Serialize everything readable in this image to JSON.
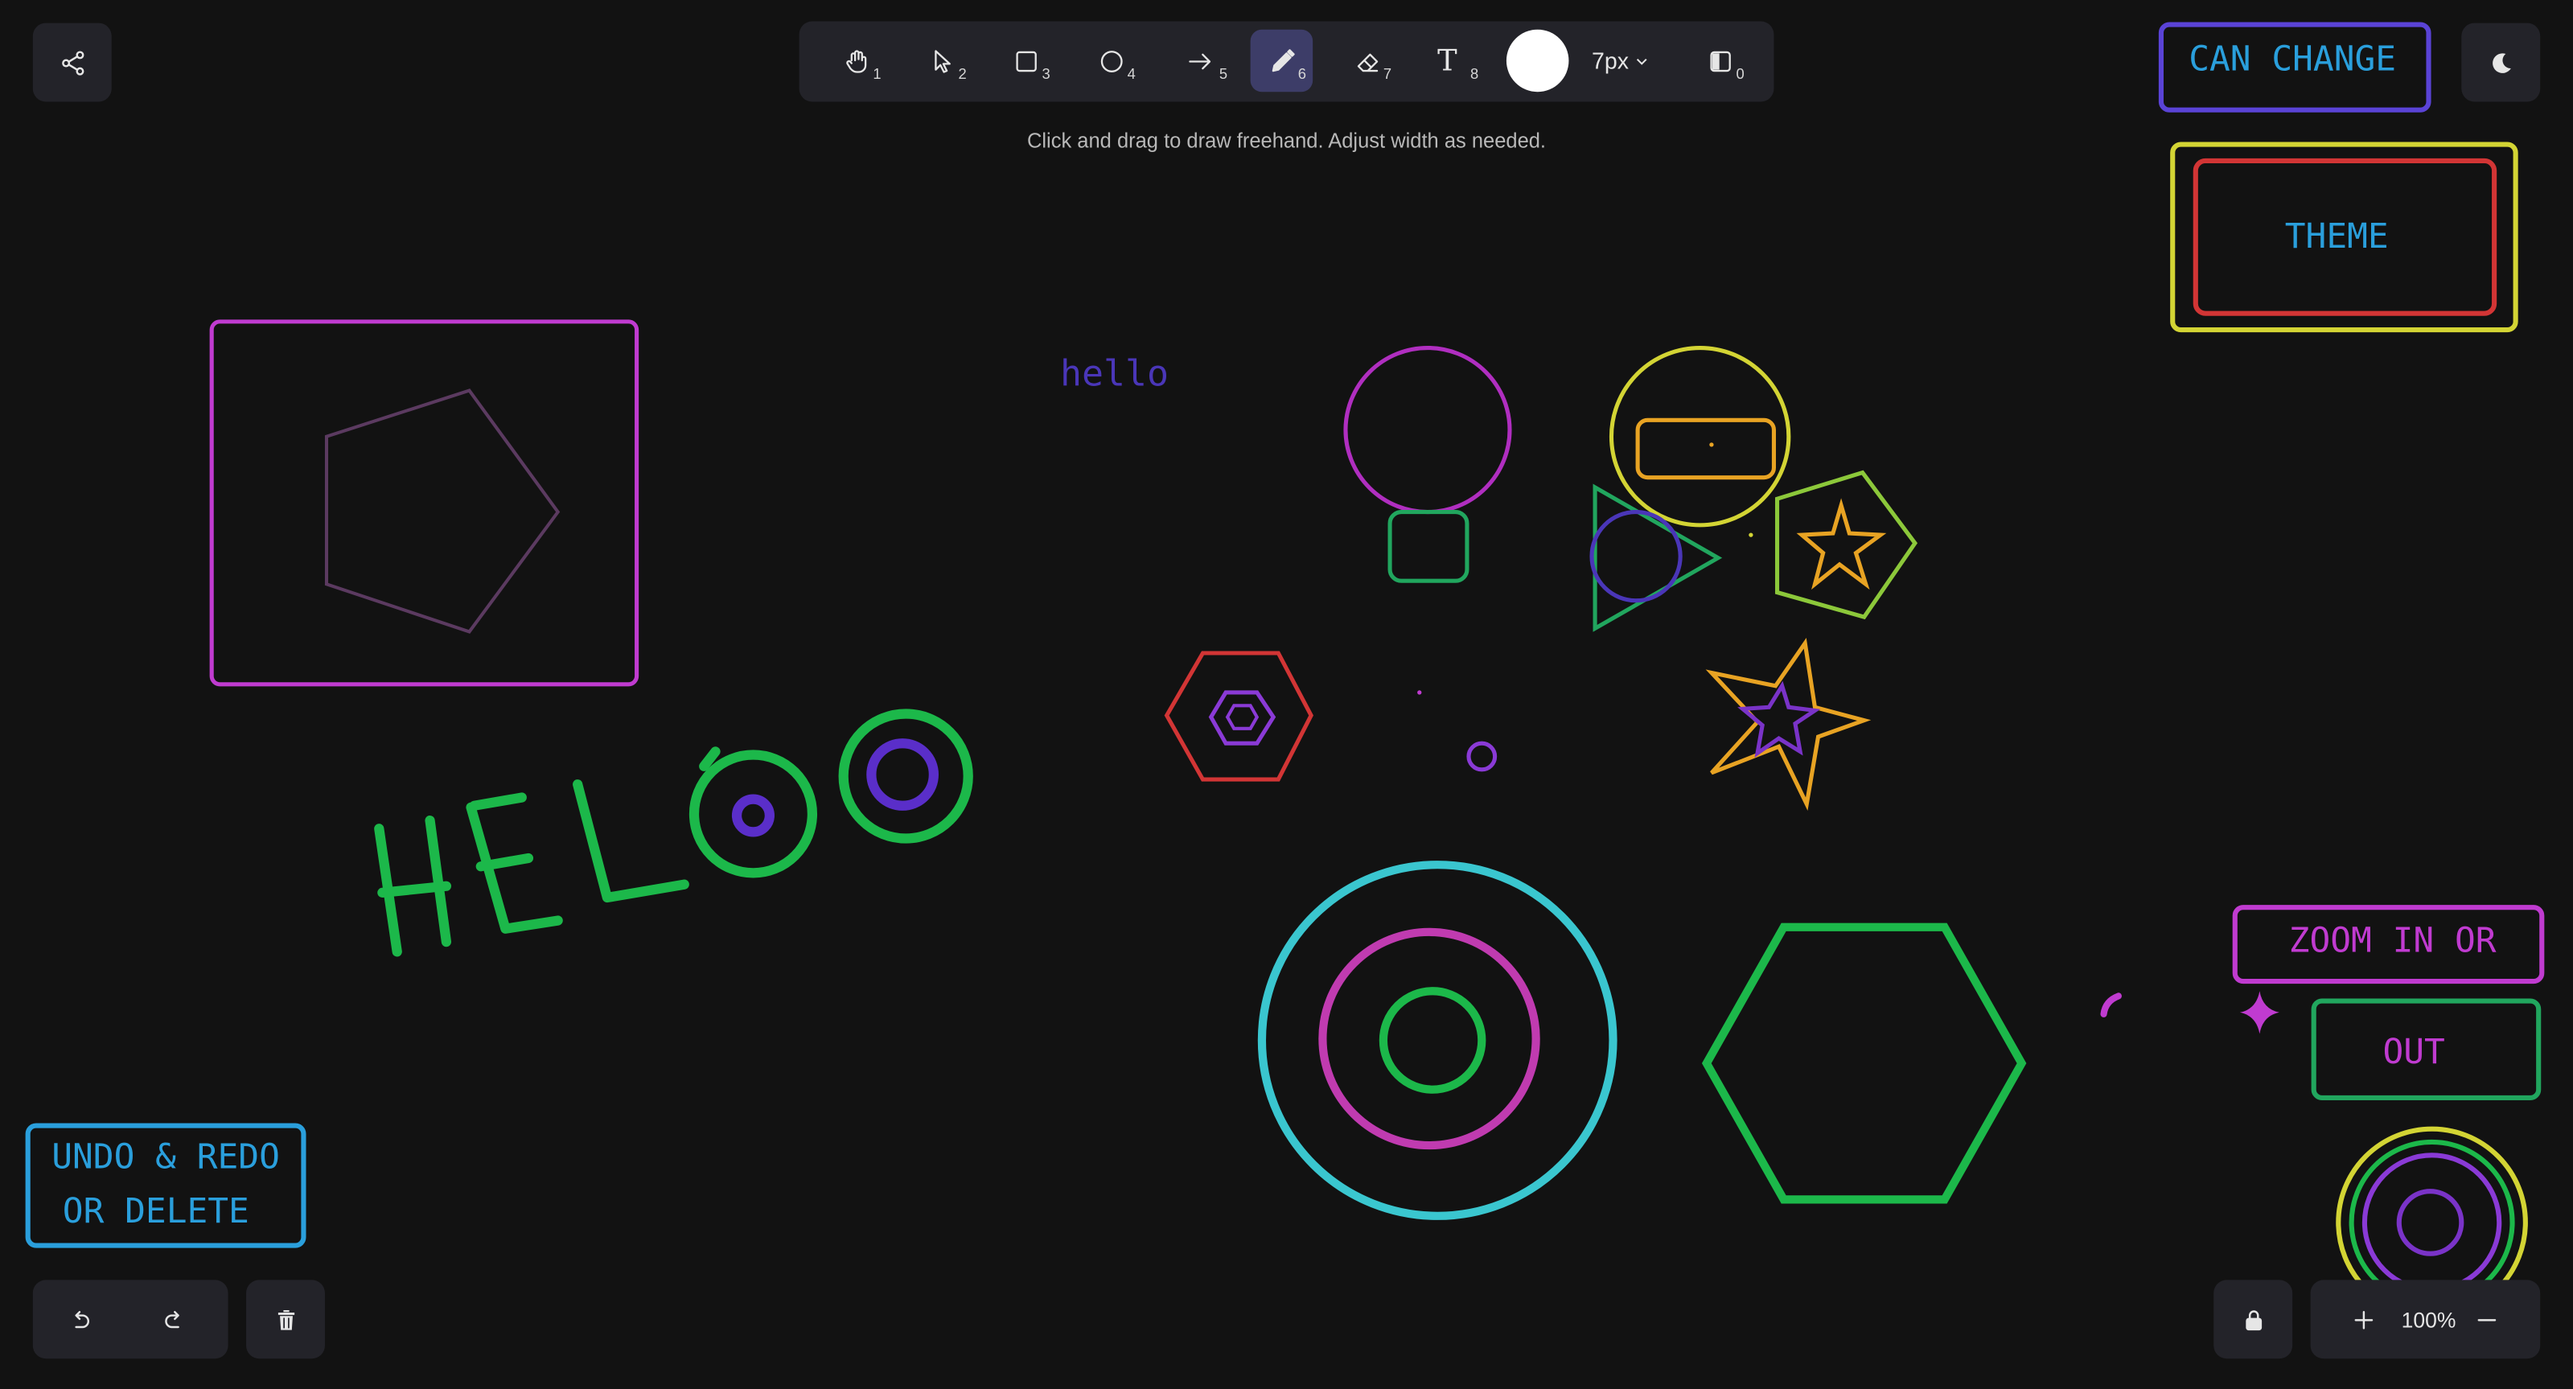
{
  "toolbar": {
    "tools": [
      {
        "name": "hand",
        "key": "1"
      },
      {
        "name": "selection",
        "key": "2"
      },
      {
        "name": "rectangle",
        "key": "3"
      },
      {
        "name": "ellipse",
        "key": "4"
      },
      {
        "name": "arrow",
        "key": "5"
      },
      {
        "name": "freedraw",
        "key": "6",
        "active": true
      },
      {
        "name": "eraser",
        "key": "7"
      },
      {
        "name": "text",
        "key": "8",
        "glyph": "T"
      }
    ],
    "stroke_color": "#ffffff",
    "stroke_width": "7px",
    "panel_toggle_key": "0"
  },
  "hint": "Click and drag to draw freehand. Adjust width as needed.",
  "canvas_text": {
    "hello": "hello",
    "can_change": "CAN CHANGE",
    "theme": "THEME",
    "undo_line1": "UNDO & REDO",
    "undo_line2": "OR DELETE",
    "zoom_line1": "ZOOM IN OR",
    "zoom_line2": "OUT"
  },
  "zoom": {
    "level": "100%"
  },
  "icons": {
    "share": "share-icon",
    "theme_toggle": "moon-icon",
    "undo": "undo-icon",
    "redo": "redo-icon",
    "delete": "trash-icon",
    "lock": "lock-icon",
    "zoom_in": "plus-icon",
    "zoom_out": "minus-icon"
  },
  "colors": {
    "background": "#121212",
    "panel": "#232329",
    "active_tool": "#3d3d68",
    "magenta": "#c03bd0",
    "green": "#1cb84a",
    "yellow": "#d3d434",
    "orange": "#e8a323",
    "cyan": "#3ac6cf",
    "purple": "#5a2ec9",
    "red": "#d23535",
    "blue": "#2a9fdc",
    "indigo": "#5a43d6"
  }
}
